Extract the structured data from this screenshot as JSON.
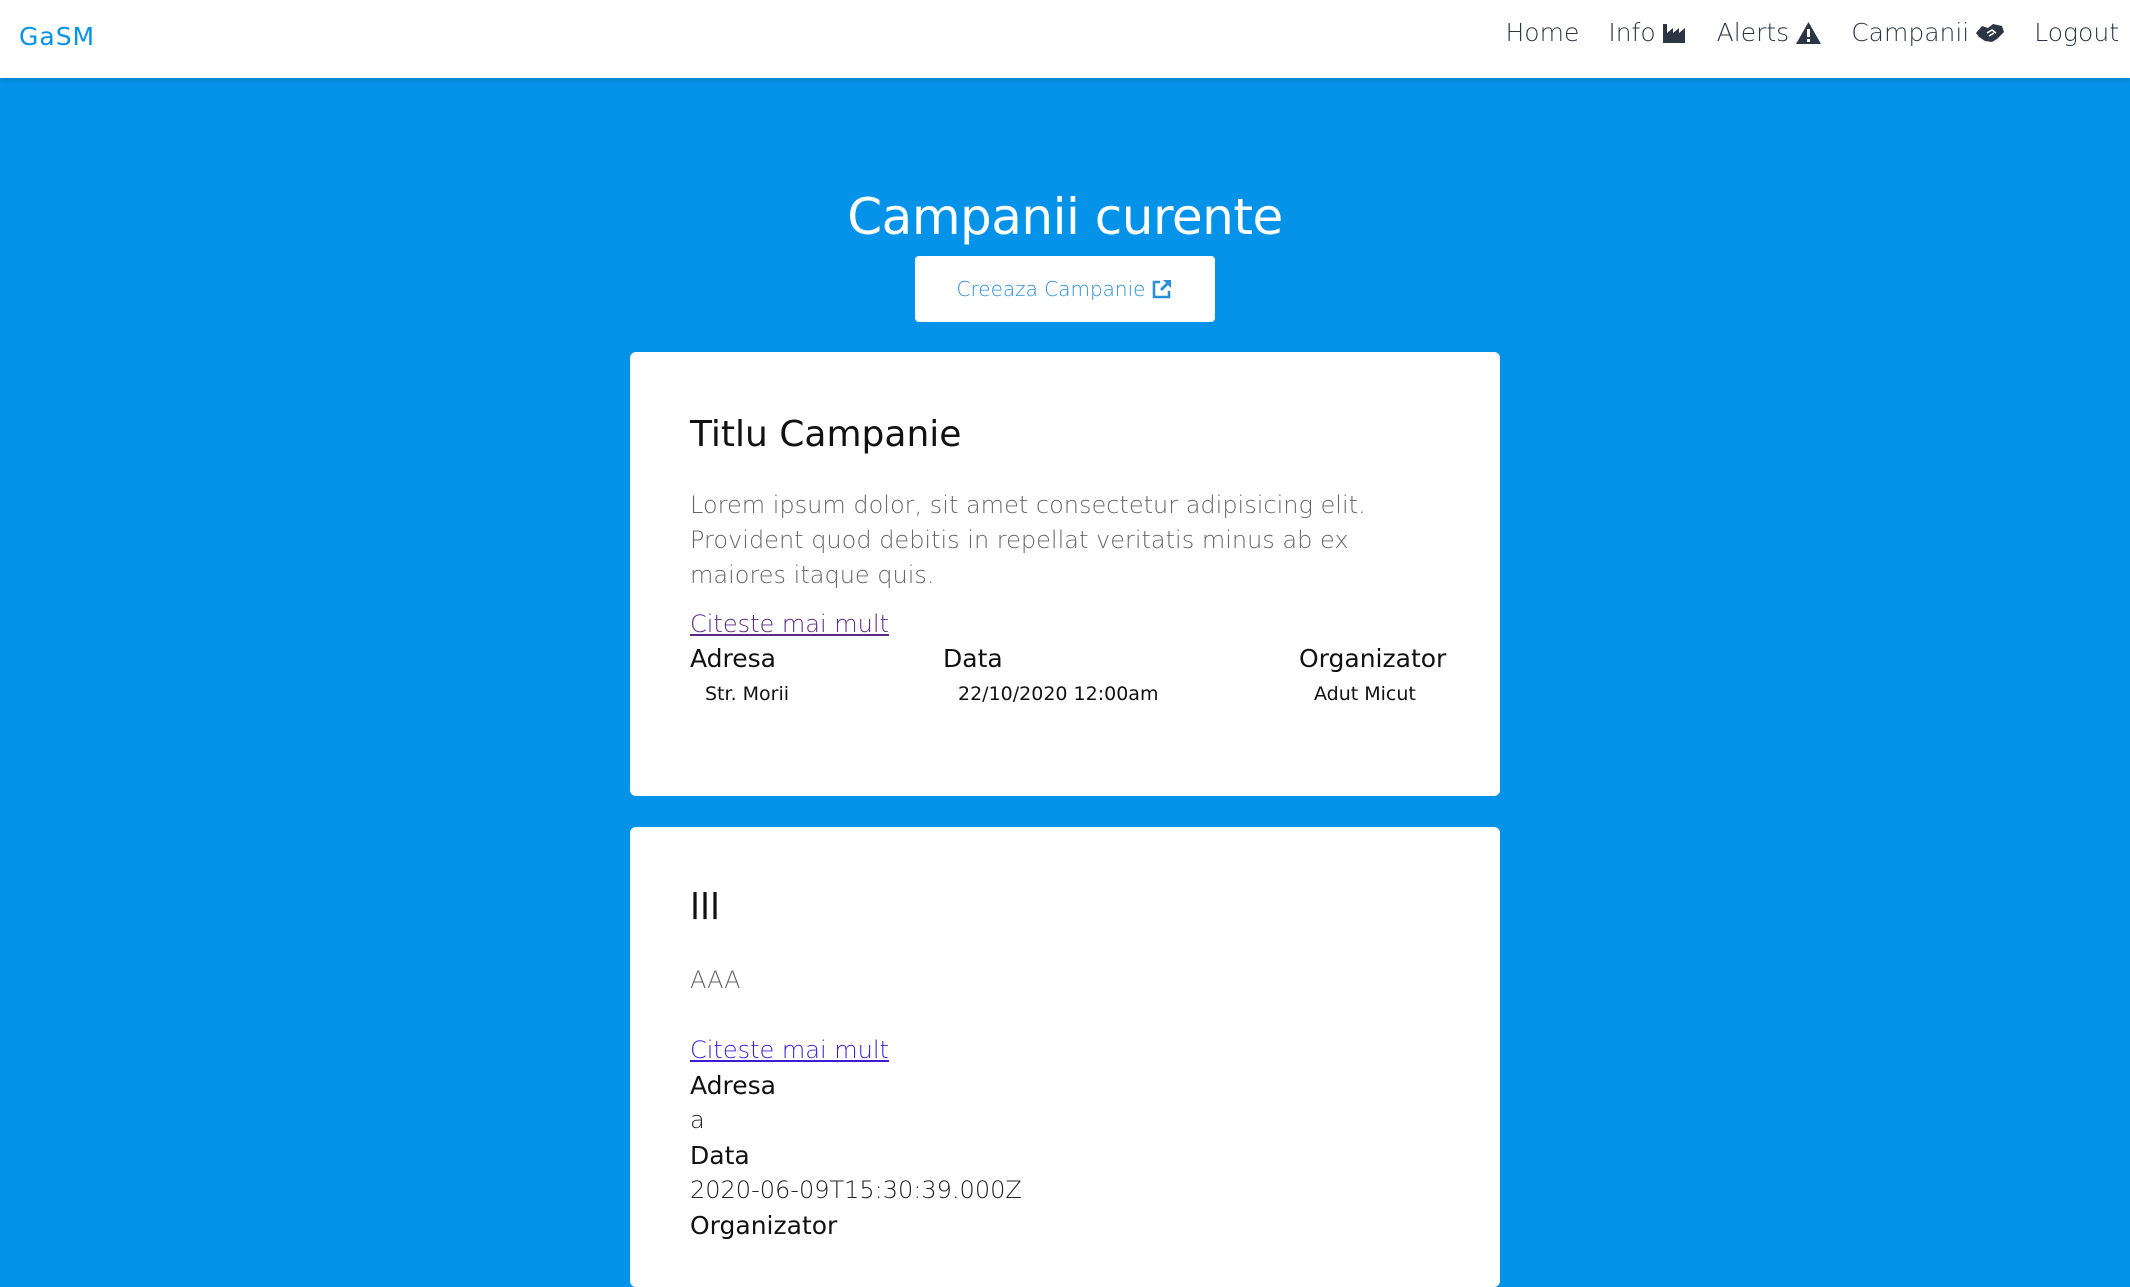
{
  "nav": {
    "brand": "GaSM",
    "links": [
      {
        "label": "Home",
        "icon": ""
      },
      {
        "label": "Info",
        "icon": "industry-icon"
      },
      {
        "label": "Alerts",
        "icon": "warning-icon"
      },
      {
        "label": "Campanii",
        "icon": "handshake-icon"
      },
      {
        "label": "Logout",
        "icon": ""
      }
    ]
  },
  "page": {
    "title": "Campanii curente",
    "create_button": "Creeaza Campanie",
    "create_icon": "external-link-icon"
  },
  "campaigns": [
    {
      "title": "Titlu Campanie",
      "description": "Lorem ipsum dolor, sit amet consectetur adipisicing elit. Provident quod debitis in repellat veritatis minus ab ex maiores itaque quis.",
      "link": "Citeste mai mult",
      "labels": {
        "address": "Adresa",
        "date": "Data",
        "organizer": "Organizator"
      },
      "address": "Str. Morii",
      "date": "22/10/2020 12:00am",
      "organizer": "Adut Micut"
    },
    {
      "title": "lll",
      "description": "AAA",
      "link": "Citeste mai mult",
      "labels": {
        "address": "Adresa",
        "date": "Data",
        "organizer": "Organizator"
      },
      "address": "a",
      "date": "2020-06-09T15:30:39.000Z",
      "organizer": ""
    }
  ],
  "colors": {
    "background": "#0593e9",
    "brand": "#0593e9",
    "nav_text": "#2b3544"
  }
}
